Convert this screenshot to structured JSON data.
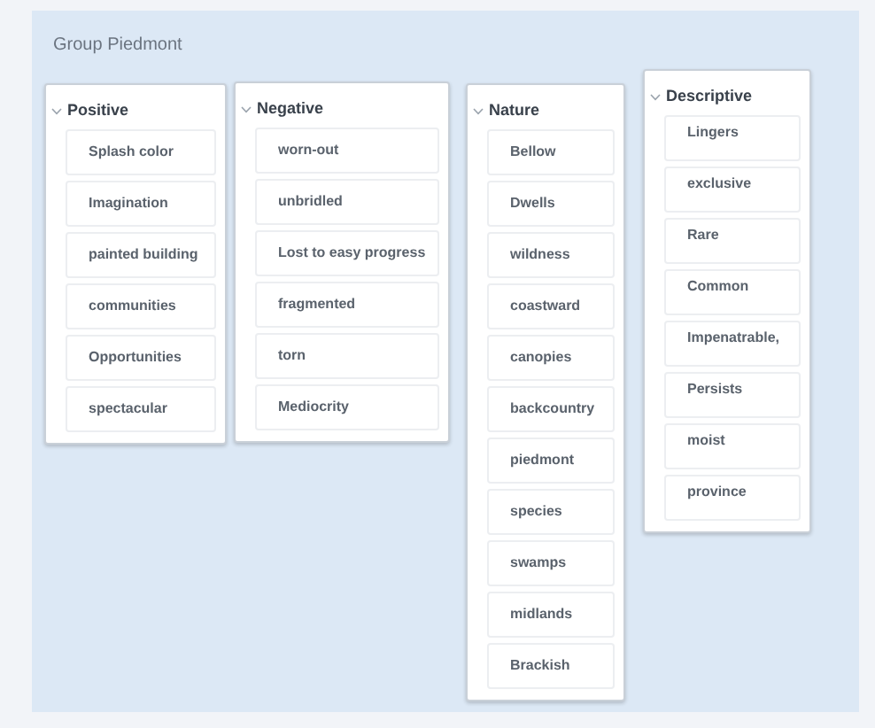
{
  "group": {
    "title": "Group Piedmont"
  },
  "columns": [
    {
      "title": "Positive",
      "items": [
        "Splash color",
        "Imagination",
        "painted building",
        "communities",
        "Opportunities",
        "spectacular"
      ]
    },
    {
      "title": "Negative",
      "items": [
        "worn-out",
        "unbridled",
        "Lost to easy progress",
        "fragmented",
        "torn",
        "Mediocrity"
      ]
    },
    {
      "title": "Nature",
      "items": [
        "Bellow",
        "Dwells",
        "wildness",
        "coastward",
        "canopies",
        "backcountry",
        "piedmont",
        "species",
        "swamps",
        "midlands",
        "Brackish"
      ]
    },
    {
      "title": "Descriptive",
      "items": [
        "Lingers",
        "exclusive",
        "Rare",
        "Common",
        "Impenatrable,",
        "Persists",
        "moist",
        "province"
      ]
    }
  ]
}
